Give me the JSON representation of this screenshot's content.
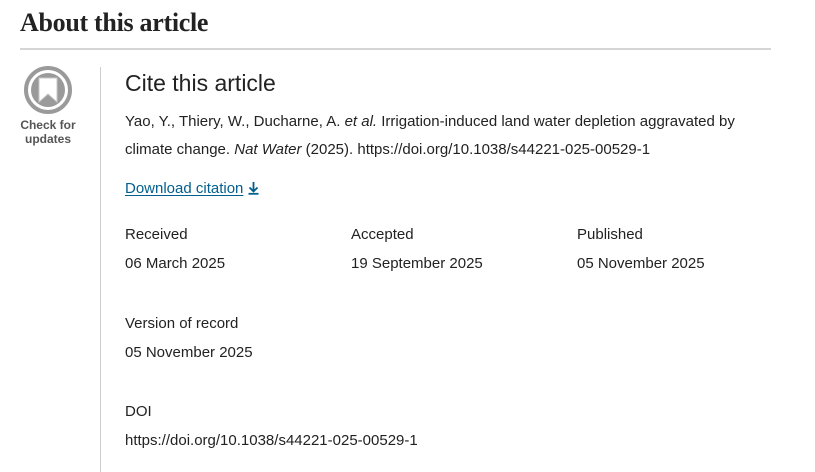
{
  "section": {
    "title": "About this article"
  },
  "badge": {
    "line1": "Check for",
    "line2": "updates"
  },
  "cite": {
    "heading": "Cite this article",
    "authors": "Yao, Y., Thiery, W., Ducharne, A. ",
    "etal": "et al.",
    "title_text": " Irrigation-induced land water depletion aggravated by climate change. ",
    "journal": "Nat Water",
    "year_doi": " (2025). https://doi.org/10.1038/s44221-025-00529-1",
    "download_label": "Download citation"
  },
  "dates": [
    {
      "label": "Received",
      "value": "06 March 2025"
    },
    {
      "label": "Accepted",
      "value": "19 September 2025"
    },
    {
      "label": "Published",
      "value": "05 November 2025"
    }
  ],
  "version": {
    "label": "Version of record",
    "value": "05 November 2025"
  },
  "doi": {
    "label": "DOI",
    "value": "https://doi.org/10.1038/s44221-025-00529-1"
  },
  "colors": {
    "link": "#025e8d",
    "badge_grey": "#9a9a9a"
  }
}
